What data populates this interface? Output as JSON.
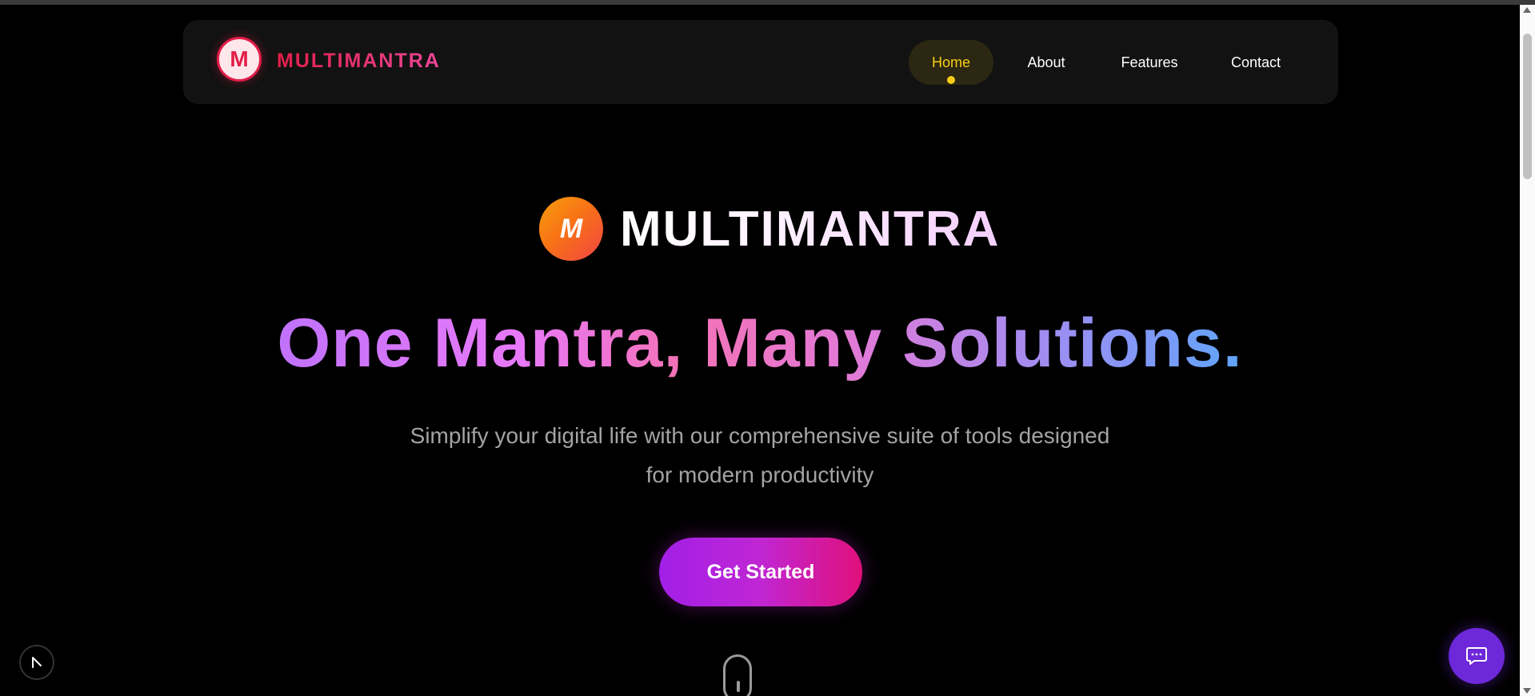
{
  "nav": {
    "logo_letter": "M",
    "brand": "MULTIMANTRA",
    "links": [
      {
        "label": "Home",
        "active": true
      },
      {
        "label": "About",
        "active": false
      },
      {
        "label": "Features",
        "active": false
      },
      {
        "label": "Contact",
        "active": false
      }
    ]
  },
  "hero": {
    "logo_letter": "M",
    "brand": "MULTIMANTRA",
    "title": "One Mantra, Many Solutions.",
    "subtitle_line1": "Simplify your digital life with our comprehensive suite of tools designed",
    "subtitle_line2": "for modern productivity",
    "cta_label": "Get Started"
  },
  "icons": {
    "scroll_indicator": "mouse-scroll-icon",
    "corner_button": "cursor-arrow-icon",
    "chat_button": "chat-bubble-icon"
  },
  "colors": {
    "background": "#000000",
    "navbar": "#121212",
    "active_nav": "#facc15",
    "brand_red": "#e11d48",
    "cta_start": "#a21fe8",
    "cta_end": "#e0107a",
    "chat": "#6d28d9"
  }
}
